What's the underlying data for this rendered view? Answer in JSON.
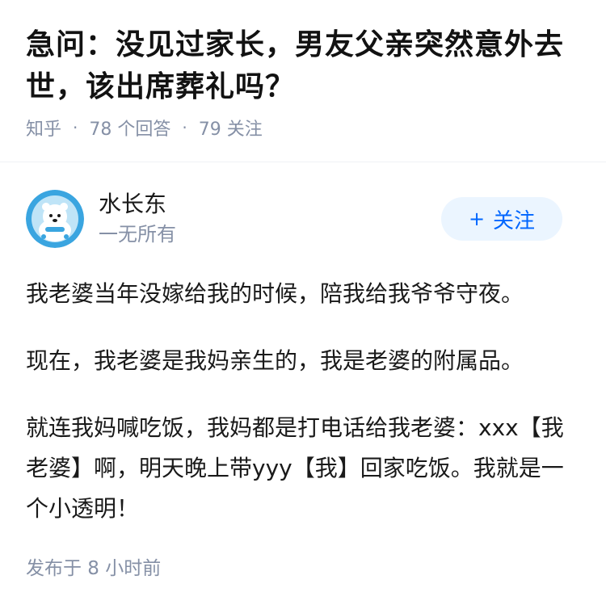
{
  "question": {
    "title": "急问：没见过家长，男友父亲突然意外去世，该出席葬礼吗？",
    "source": "知乎",
    "answers": "78 个回答",
    "follows": "79 关注"
  },
  "author": {
    "name": "水长东",
    "bio": "一无所有",
    "follow_label": "关注",
    "follow_icon": "plus-icon"
  },
  "content": {
    "paragraphs": [
      "我老婆当年没嫁给我的时候，陪我给我爷爷守夜。",
      "现在，我老婆是我妈亲生的，我是老婆的附属品。",
      "就连我妈喊吃饭，我妈都是打电话给我老婆：xxx【我老婆】啊，明天晚上带yyy【我】回家吃饭。我就是一个小透明！"
    ]
  },
  "meta": {
    "published": "发布于 8 小时前"
  },
  "colors": {
    "accent": "#0066ff",
    "follow_bg": "#ebf5ff",
    "muted": "#8590a6",
    "text": "#1a1a1a"
  }
}
